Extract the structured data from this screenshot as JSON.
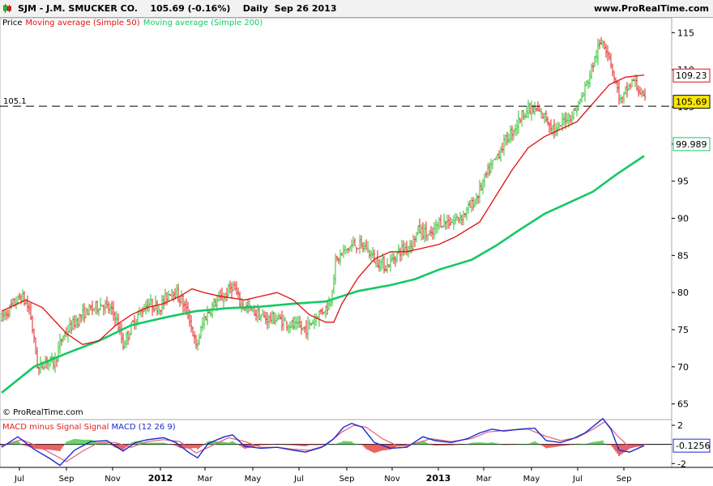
{
  "header": {
    "symbol": "SJM - J.M. SMUCKER CO.",
    "quote": "105.69 (-0.16%)",
    "period": "Daily",
    "date": "Sep 26 2013",
    "site": "www.ProRealTime.com"
  },
  "legend": {
    "price": "Price",
    "ma50": "Moving average (Simple 50)",
    "ma200": "Moving average (Simple 200)"
  },
  "copyright": "© ProRealTime.com",
  "macd_legend": {
    "hist": "MACD minus Signal Signal",
    "macd": "MACD (12 26 9)"
  },
  "colors": {
    "bull": "#2bbf2b",
    "bear": "#e02020",
    "ma50": "#e01010",
    "ma200": "#14c964",
    "macd": "#1a2bcc",
    "axis": "#000000"
  },
  "chart_data": [
    {
      "type": "candlestick",
      "title": "SJM - J.M. SMUCKER CO.",
      "ylim": [
        63,
        117
      ],
      "yticks": [
        65,
        70,
        75,
        80,
        85,
        90,
        95,
        100,
        105,
        110,
        115
      ],
      "ytick_labels": [
        "65",
        "70",
        "75",
        "80",
        "85",
        "90",
        "95",
        "100",
        "105",
        "110",
        "115"
      ],
      "xticks": [
        "Jul",
        "Sep",
        "Nov",
        "2012",
        "Mar",
        "May",
        "Jul",
        "Sep",
        "Nov",
        "2013",
        "Mar",
        "May",
        "Jul",
        "Sep"
      ],
      "price_line": {
        "label": "105.1",
        "value": 105.1
      },
      "last_price": 105.69,
      "ma50_last": 109.23,
      "ma200_last": 99.989,
      "price_anchors": [
        [
          0,
          76.5
        ],
        [
          15,
          78.5
        ],
        [
          25,
          79.5
        ],
        [
          35,
          77.5
        ],
        [
          45,
          69.5
        ],
        [
          55,
          71
        ],
        [
          65,
          70.5
        ],
        [
          75,
          74
        ],
        [
          90,
          76
        ],
        [
          105,
          77.5
        ],
        [
          125,
          78.5
        ],
        [
          140,
          77
        ],
        [
          150,
          73
        ],
        [
          165,
          76.5
        ],
        [
          180,
          78.5
        ],
        [
          195,
          78
        ],
        [
          210,
          80.5
        ],
        [
          222,
          79
        ],
        [
          232,
          76.5
        ],
        [
          240,
          72.5
        ],
        [
          250,
          76.5
        ],
        [
          262,
          78.5
        ],
        [
          275,
          79.5
        ],
        [
          285,
          81
        ],
        [
          295,
          78.5
        ],
        [
          310,
          77.5
        ],
        [
          325,
          76.5
        ],
        [
          340,
          76.5
        ],
        [
          360,
          75.5
        ],
        [
          375,
          75
        ],
        [
          390,
          77
        ],
        [
          405,
          78.5
        ],
        [
          412,
          84
        ],
        [
          422,
          85.5
        ],
        [
          435,
          86.5
        ],
        [
          450,
          86
        ],
        [
          460,
          84.5
        ],
        [
          475,
          83.5
        ],
        [
          490,
          85.5
        ],
        [
          505,
          86.5
        ],
        [
          515,
          88.5
        ],
        [
          530,
          87.5
        ],
        [
          540,
          89.5
        ],
        [
          555,
          89.5
        ],
        [
          570,
          90.5
        ],
        [
          585,
          92.5
        ],
        [
          597,
          95.5
        ],
        [
          612,
          98.5
        ],
        [
          622,
          100.5
        ],
        [
          635,
          102.5
        ],
        [
          645,
          104.5
        ],
        [
          660,
          104.5
        ],
        [
          672,
          103.5
        ],
        [
          685,
          101.5
        ],
        [
          695,
          103.5
        ],
        [
          705,
          104
        ],
        [
          715,
          106
        ],
        [
          725,
          109
        ],
        [
          735,
          112.5
        ],
        [
          742,
          114
        ],
        [
          750,
          112
        ],
        [
          758,
          108
        ],
        [
          765,
          105.5
        ],
        [
          772,
          107.5
        ],
        [
          780,
          108.5
        ],
        [
          788,
          107
        ],
        [
          793,
          105.7
        ]
      ],
      "ma50_anchors": [
        [
          0,
          77.5
        ],
        [
          30,
          79
        ],
        [
          50,
          78
        ],
        [
          80,
          74.5
        ],
        [
          100,
          73
        ],
        [
          120,
          73.5
        ],
        [
          140,
          75.5
        ],
        [
          160,
          77
        ],
        [
          180,
          78
        ],
        [
          200,
          78.5
        ],
        [
          220,
          79.5
        ],
        [
          235,
          80.5
        ],
        [
          250,
          80
        ],
        [
          270,
          79.5
        ],
        [
          300,
          79
        ],
        [
          320,
          79.5
        ],
        [
          340,
          80
        ],
        [
          360,
          79
        ],
        [
          380,
          77
        ],
        [
          400,
          76
        ],
        [
          410,
          76
        ],
        [
          420,
          78.5
        ],
        [
          440,
          82
        ],
        [
          460,
          84.5
        ],
        [
          480,
          85.5
        ],
        [
          500,
          85.5
        ],
        [
          520,
          86
        ],
        [
          540,
          86.5
        ],
        [
          560,
          87.5
        ],
        [
          590,
          89.5
        ],
        [
          610,
          93
        ],
        [
          630,
          96.5
        ],
        [
          650,
          99.5
        ],
        [
          670,
          101
        ],
        [
          690,
          102
        ],
        [
          710,
          103
        ],
        [
          730,
          105.5
        ],
        [
          750,
          108
        ],
        [
          770,
          109
        ],
        [
          793,
          109.3
        ]
      ],
      "ma200_anchors": [
        [
          0,
          66.5
        ],
        [
          40,
          70
        ],
        [
          80,
          71.8
        ],
        [
          120,
          73.5
        ],
        [
          160,
          75.6
        ],
        [
          200,
          76.6
        ],
        [
          240,
          77.5
        ],
        [
          280,
          77.9
        ],
        [
          320,
          78.1
        ],
        [
          360,
          78.5
        ],
        [
          400,
          78.8
        ],
        [
          440,
          80.2
        ],
        [
          480,
          81
        ],
        [
          510,
          81.8
        ],
        [
          540,
          83.1
        ],
        [
          580,
          84.4
        ],
        [
          610,
          86.3
        ],
        [
          640,
          88.5
        ],
        [
          670,
          90.6
        ],
        [
          700,
          92.1
        ],
        [
          730,
          93.6
        ],
        [
          760,
          96
        ],
        [
          793,
          98.4
        ]
      ]
    },
    {
      "type": "macd",
      "title": "MACD (12 26 9)",
      "ylim": [
        -2.4,
        2.6
      ],
      "yticks": [
        2,
        -2
      ],
      "ytick_labels": [
        "2",
        "-2"
      ],
      "last_value": -0.1256,
      "macd_anchors": [
        [
          0,
          -0.3
        ],
        [
          20,
          0.8
        ],
        [
          40,
          -0.5
        ],
        [
          60,
          -1.5
        ],
        [
          72,
          -2.2
        ],
        [
          90,
          -0.6
        ],
        [
          110,
          0.3
        ],
        [
          130,
          0.4
        ],
        [
          150,
          -0.7
        ],
        [
          165,
          0.2
        ],
        [
          180,
          0.5
        ],
        [
          200,
          0.7
        ],
        [
          215,
          0.2
        ],
        [
          232,
          -0.9
        ],
        [
          242,
          -1.4
        ],
        [
          255,
          0.1
        ],
        [
          275,
          0.8
        ],
        [
          285,
          1.0
        ],
        [
          300,
          -0.2
        ],
        [
          320,
          -0.4
        ],
        [
          340,
          -0.3
        ],
        [
          360,
          -0.6
        ],
        [
          375,
          -0.8
        ],
        [
          395,
          -0.3
        ],
        [
          410,
          0.6
        ],
        [
          422,
          1.8
        ],
        [
          432,
          2.2
        ],
        [
          445,
          1.8
        ],
        [
          460,
          0.2
        ],
        [
          480,
          -0.4
        ],
        [
          500,
          -0.3
        ],
        [
          520,
          0.8
        ],
        [
          535,
          0.4
        ],
        [
          555,
          0.2
        ],
        [
          575,
          0.6
        ],
        [
          590,
          1.2
        ],
        [
          605,
          1.6
        ],
        [
          620,
          1.4
        ],
        [
          640,
          1.6
        ],
        [
          658,
          1.7
        ],
        [
          672,
          0.4
        ],
        [
          690,
          0.2
        ],
        [
          705,
          0.6
        ],
        [
          720,
          1.2
        ],
        [
          742,
          2.7
        ],
        [
          752,
          1.6
        ],
        [
          762,
          -0.6
        ],
        [
          775,
          -0.8
        ],
        [
          793,
          -0.13
        ]
      ],
      "signal_anchors": [
        [
          0,
          -0.1
        ],
        [
          25,
          0.5
        ],
        [
          45,
          -0.2
        ],
        [
          65,
          -1.1
        ],
        [
          80,
          -1.8
        ],
        [
          100,
          -0.7
        ],
        [
          120,
          0.2
        ],
        [
          140,
          0.2
        ],
        [
          160,
          -0.3
        ],
        [
          180,
          0.3
        ],
        [
          200,
          0.5
        ],
        [
          220,
          0.3
        ],
        [
          240,
          -0.9
        ],
        [
          260,
          -0.1
        ],
        [
          280,
          0.7
        ],
        [
          300,
          0.3
        ],
        [
          320,
          -0.3
        ],
        [
          340,
          -0.3
        ],
        [
          360,
          -0.5
        ],
        [
          380,
          -0.6
        ],
        [
          400,
          -0.1
        ],
        [
          420,
          1.3
        ],
        [
          435,
          2.0
        ],
        [
          450,
          1.8
        ],
        [
          470,
          0.6
        ],
        [
          490,
          -0.2
        ],
        [
          510,
          0.1
        ],
        [
          530,
          0.6
        ],
        [
          555,
          0.3
        ],
        [
          580,
          0.6
        ],
        [
          600,
          1.3
        ],
        [
          625,
          1.5
        ],
        [
          650,
          1.6
        ],
        [
          670,
          0.9
        ],
        [
          690,
          0.4
        ],
        [
          710,
          0.7
        ],
        [
          730,
          1.6
        ],
        [
          745,
          2.4
        ],
        [
          760,
          0.9
        ],
        [
          775,
          -0.3
        ],
        [
          793,
          -0.1
        ]
      ]
    }
  ]
}
